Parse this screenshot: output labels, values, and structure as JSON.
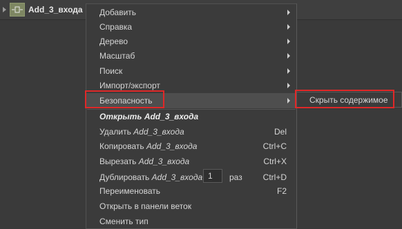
{
  "tree": {
    "node_label": "Add_3_входа",
    "node_icon": "block-node-icon"
  },
  "menu": {
    "items": [
      {
        "label": "Добавить",
        "submenu": true
      },
      {
        "label": "Справка",
        "submenu": true
      },
      {
        "label": "Дерево",
        "submenu": true
      },
      {
        "label": "Масштаб",
        "submenu": true
      },
      {
        "label": "Поиск",
        "submenu": true
      },
      {
        "label": "Импорт/экспорт",
        "submenu": true
      },
      {
        "label": "Безопасность",
        "submenu": true,
        "selected": true
      }
    ],
    "open": {
      "label": "Открыть",
      "object": "Add_3_входа"
    },
    "delete": {
      "label": "Удалить",
      "object": "Add_3_входа",
      "shortcut": "Del"
    },
    "copy": {
      "label": "Копировать",
      "object": "Add_3_входа",
      "shortcut": "Ctrl+C"
    },
    "cut": {
      "label": "Вырезать",
      "object": "Add_3_входа",
      "shortcut": "Ctrl+X"
    },
    "duplicate": {
      "label": "Дублировать",
      "object": "Add_3_входа",
      "count": "1",
      "suffix": "раз",
      "shortcut": "Ctrl+D"
    },
    "rename": {
      "label": "Переименовать",
      "shortcut": "F2"
    },
    "open_in_branch_panel": {
      "label": "Открыть в панели веток"
    },
    "change_type": {
      "label": "Сменить тип"
    }
  },
  "submenu": {
    "items": [
      {
        "label": "Скрыть содержимое"
      }
    ]
  },
  "colors": {
    "highlight": "#e02828",
    "menu_bg": "#3b3b3b",
    "selected_bg": "#4e4e4e"
  }
}
